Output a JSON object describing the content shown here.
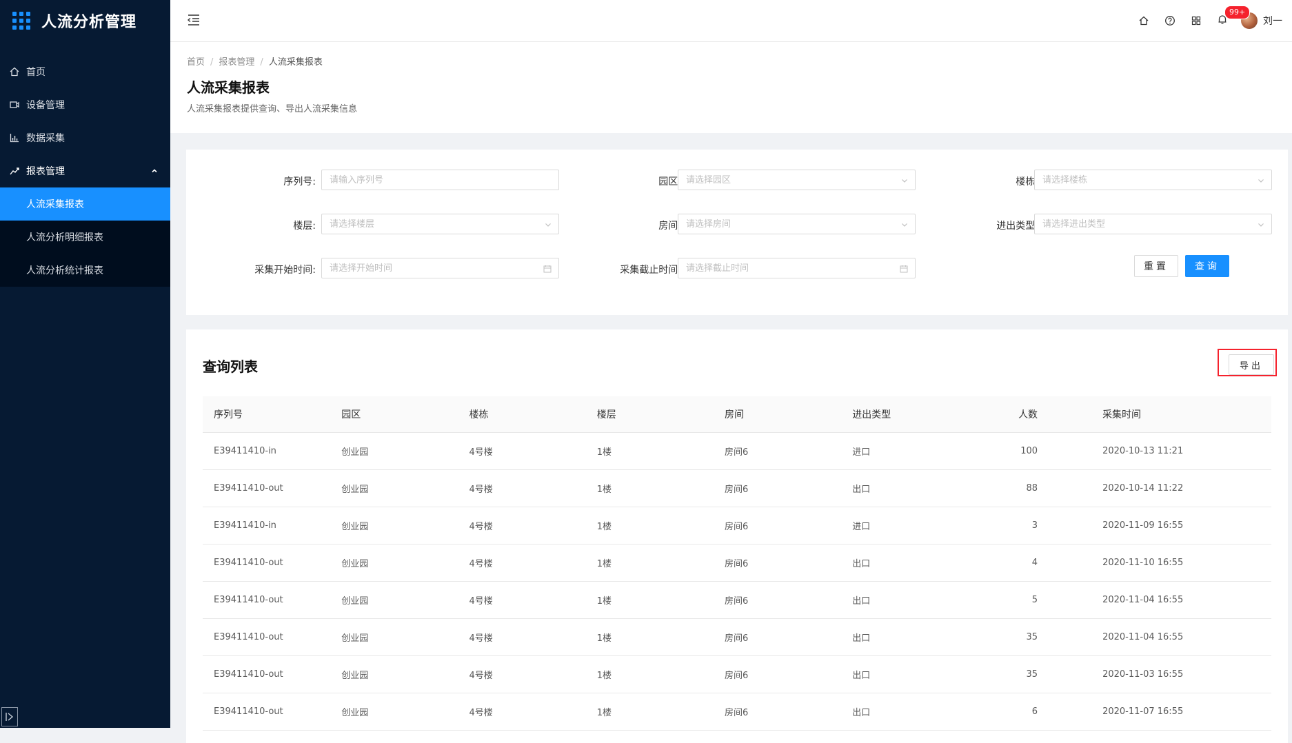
{
  "app": {
    "title": "人流分析管理"
  },
  "sidebar": {
    "items": [
      {
        "label": "首页",
        "icon": "home-icon"
      },
      {
        "label": "设备管理",
        "icon": "device-icon"
      },
      {
        "label": "数据采集",
        "icon": "bar-chart-icon"
      },
      {
        "label": "报表管理",
        "icon": "line-chart-icon"
      }
    ],
    "submenu": [
      {
        "label": "人流采集报表",
        "active": true
      },
      {
        "label": "人流分析明细报表",
        "active": false
      },
      {
        "label": "人流分析统计报表",
        "active": false
      }
    ]
  },
  "topbar": {
    "badge": "99+",
    "username": "刘一"
  },
  "breadcrumb": [
    "首页",
    "报表管理",
    "人流采集报表"
  ],
  "page": {
    "title": "人流采集报表",
    "description": "人流采集报表提供查询、导出人流采集信息"
  },
  "filters": {
    "serial": {
      "label": "序列号:",
      "placeholder": "请输入序列号"
    },
    "park": {
      "label": "园区:",
      "placeholder": "请选择园区"
    },
    "building": {
      "label": "楼栋:",
      "placeholder": "请选择楼栋"
    },
    "floor": {
      "label": "楼层:",
      "placeholder": "请选择楼层"
    },
    "room": {
      "label": "房间:",
      "placeholder": "请选择房间"
    },
    "direction": {
      "label": "进出类型:",
      "placeholder": "请选择进出类型"
    },
    "start_time": {
      "label": "采集开始时间:",
      "placeholder": "请选择开始时间"
    },
    "end_time": {
      "label": "采集截止时间:",
      "placeholder": "请选择截止时间"
    },
    "reset_label": "重置",
    "query_label": "查询"
  },
  "list": {
    "title": "查询列表",
    "export_label": "导出",
    "columns": [
      "序列号",
      "园区",
      "楼栋",
      "楼层",
      "房间",
      "进出类型",
      "人数",
      "采集时间"
    ],
    "rows": [
      [
        "E39411410-in",
        "创业园",
        "4号楼",
        "1楼",
        "房间6",
        "进口",
        "100",
        "2020-10-13 11:21"
      ],
      [
        "E39411410-out",
        "创业园",
        "4号楼",
        "1楼",
        "房间6",
        "出口",
        "88",
        "2020-10-14 11:22"
      ],
      [
        "E39411410-in",
        "创业园",
        "4号楼",
        "1楼",
        "房间6",
        "进口",
        "3",
        "2020-11-09 16:55"
      ],
      [
        "E39411410-out",
        "创业园",
        "4号楼",
        "1楼",
        "房间6",
        "出口",
        "4",
        "2020-11-10 16:55"
      ],
      [
        "E39411410-out",
        "创业园",
        "4号楼",
        "1楼",
        "房间6",
        "出口",
        "5",
        "2020-11-04 16:55"
      ],
      [
        "E39411410-out",
        "创业园",
        "4号楼",
        "1楼",
        "房间6",
        "出口",
        "35",
        "2020-11-04 16:55"
      ],
      [
        "E39411410-out",
        "创业园",
        "4号楼",
        "1楼",
        "房间6",
        "出口",
        "35",
        "2020-11-03 16:55"
      ],
      [
        "E39411410-out",
        "创业园",
        "4号楼",
        "1楼",
        "房间6",
        "出口",
        "6",
        "2020-11-07 16:55"
      ]
    ]
  }
}
